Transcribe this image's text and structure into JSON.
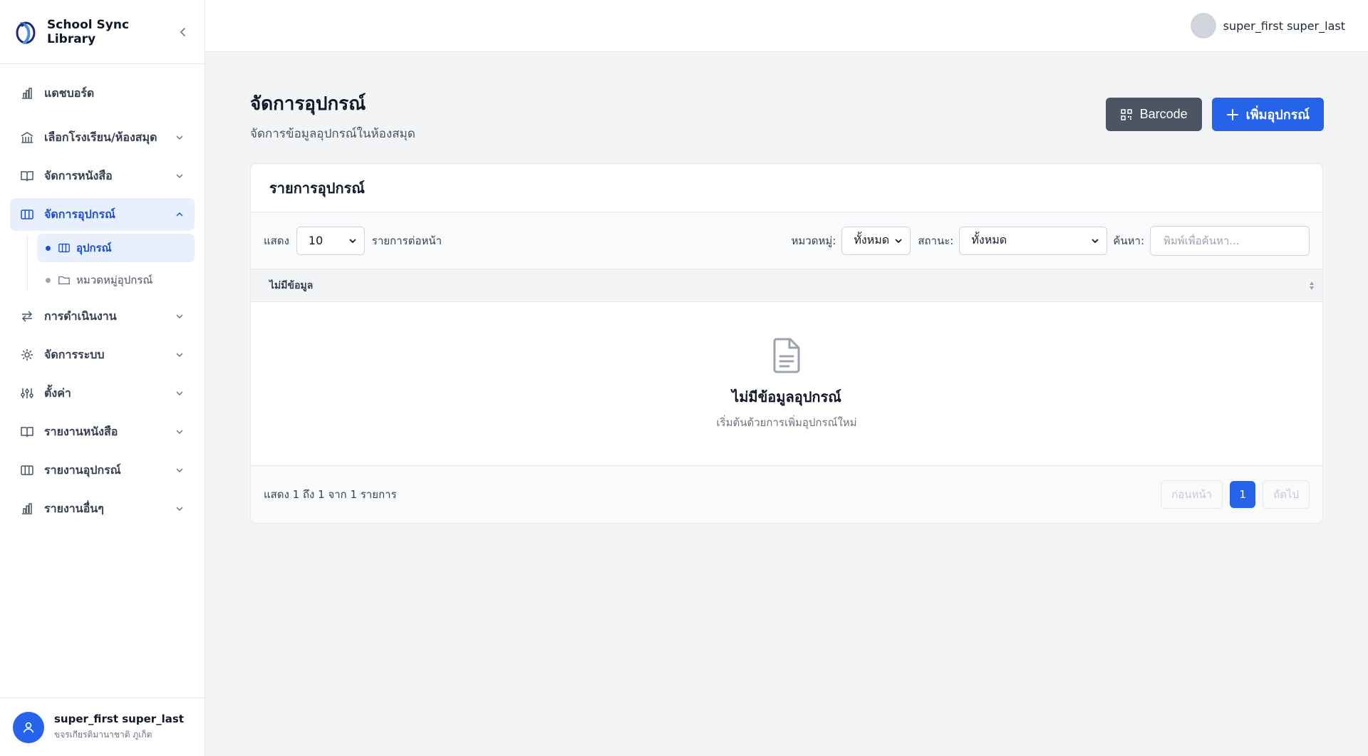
{
  "app": {
    "name": "School Sync Library"
  },
  "sidebar": {
    "items": [
      {
        "label": "แดชบอร์ด",
        "icon": "chart-bar-icon"
      },
      {
        "label": "เลือกโรงเรียน/ห้องสมุด",
        "icon": "library-icon"
      },
      {
        "label": "จัดการหนังสือ",
        "icon": "book-open-icon"
      },
      {
        "label": "จัดการอุปกรณ์",
        "icon": "columns-icon",
        "active": true
      },
      {
        "label": "การดำเนินงาน",
        "icon": "arrows-swap-icon"
      },
      {
        "label": "จัดการระบบ",
        "icon": "gear-icon"
      },
      {
        "label": "ตั้งค่า",
        "icon": "sliders-icon"
      },
      {
        "label": "รายงานหนังสือ",
        "icon": "book-open-icon"
      },
      {
        "label": "รายงานอุปกรณ์",
        "icon": "columns-icon"
      },
      {
        "label": "รายงานอื่นๆ",
        "icon": "chart-bar-icon"
      }
    ],
    "subitems": [
      {
        "label": "อุปกรณ์",
        "icon": "columns-icon",
        "active": true
      },
      {
        "label": "หมวดหมู่อุปกรณ์",
        "icon": "folder-icon"
      }
    ],
    "user": {
      "name": "super_first super_last",
      "school": "ขจรเกียรติมานาชาติ ภูเก็ต"
    }
  },
  "topbar": {
    "user_name": "super_first super_last"
  },
  "page": {
    "title": "จัดการอุปกรณ์",
    "subtitle": "จัดการข้อมูลอุปกรณ์ในห้องสมุด",
    "barcode_label": "Barcode",
    "add_label": "เพิ่มอุปกรณ์"
  },
  "card": {
    "title": "รายการอุปกรณ์",
    "show_label": "แสดง",
    "page_size": "10",
    "per_page_label": "รายการต่อหน้า",
    "category_label": "หมวดหมู่:",
    "category_value": "ทั้งหมด",
    "status_label": "สถานะ:",
    "status_value": "ทั้งหมด",
    "search_label": "ค้นหา:",
    "search_placeholder": "พิมพ์เพื่อค้นหา...",
    "column_header": "ไม่มีข้อมูล",
    "empty_title": "ไม่มีข้อมูลอุปกรณ์",
    "empty_sub": "เริ่มต้นด้วยการเพิ่มอุปกรณ์ใหม่",
    "summary": "แสดง 1 ถึง 1 จาก 1 รายการ",
    "prev_label": "ก่อนหน้า",
    "current_page": "1",
    "next_label": "ถัดไป"
  },
  "colors": {
    "accent": "#2563eb",
    "active_bg": "#e8f0fe",
    "dark_button": "#4b5563"
  }
}
